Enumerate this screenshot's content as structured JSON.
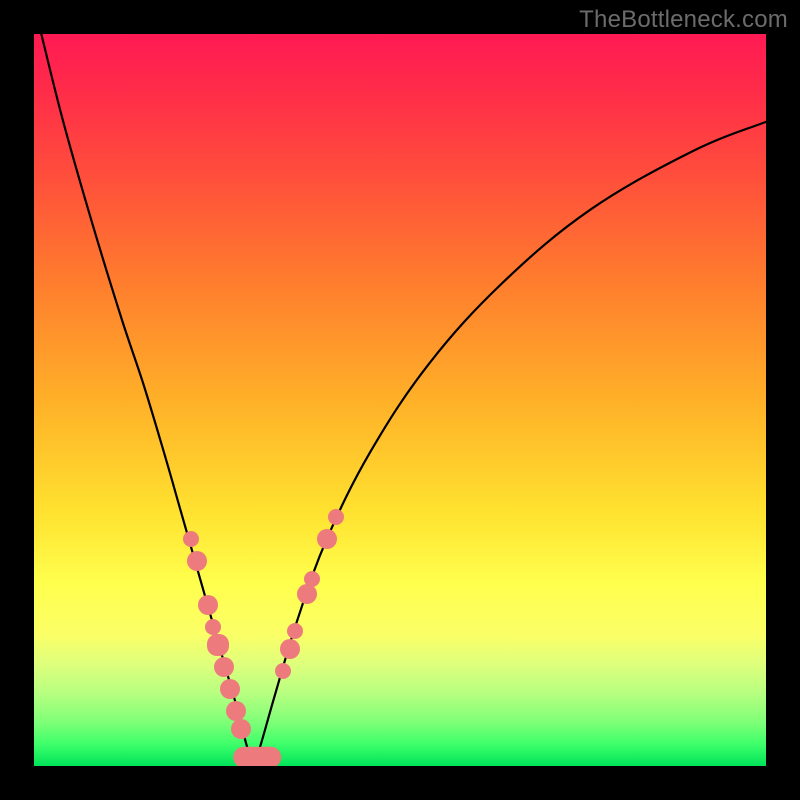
{
  "watermark": "TheBottleneck.com",
  "chart_data": {
    "type": "line",
    "title": "",
    "xlabel": "",
    "ylabel": "",
    "xlim": [
      0,
      100
    ],
    "ylim": [
      0,
      100
    ],
    "grid": false,
    "legend": false,
    "background_gradient": {
      "direction": "top-to-bottom",
      "stops": [
        {
          "pos": 0.0,
          "color": "#ff1a53"
        },
        {
          "pos": 0.18,
          "color": "#ff4a3d"
        },
        {
          "pos": 0.33,
          "color": "#ff7a2e"
        },
        {
          "pos": 0.5,
          "color": "#ffb028"
        },
        {
          "pos": 0.65,
          "color": "#ffe12f"
        },
        {
          "pos": 0.82,
          "color": "#fbff66"
        },
        {
          "pos": 0.9,
          "color": "#b8ff80"
        },
        {
          "pos": 1.0,
          "color": "#00e35a"
        }
      ]
    },
    "series": [
      {
        "name": "left-branch",
        "x": [
          1,
          4,
          8,
          12,
          15,
          18,
          20,
          22,
          24,
          26,
          28,
          29,
          30
        ],
        "y": [
          100,
          88,
          74,
          61,
          52,
          42,
          35,
          28,
          21,
          14,
          7,
          3,
          0
        ]
      },
      {
        "name": "right-branch",
        "x": [
          30,
          31,
          33,
          36,
          40,
          46,
          54,
          64,
          76,
          90,
          100
        ],
        "y": [
          0,
          3,
          10,
          20,
          31,
          43,
          55,
          66,
          76,
          84,
          88
        ]
      }
    ],
    "markers": [
      {
        "x": 21.5,
        "y": 31,
        "size": "sm"
      },
      {
        "x": 22.2,
        "y": 28,
        "size": "md"
      },
      {
        "x": 23.8,
        "y": 22,
        "size": "md"
      },
      {
        "x": 24.5,
        "y": 19,
        "size": "sm"
      },
      {
        "x": 25.2,
        "y": 16.5,
        "size": "lg"
      },
      {
        "x": 26.0,
        "y": 13.5,
        "size": "md"
      },
      {
        "x": 26.8,
        "y": 10.5,
        "size": "md"
      },
      {
        "x": 27.6,
        "y": 7.5,
        "size": "md"
      },
      {
        "x": 28.3,
        "y": 5.0,
        "size": "md"
      },
      {
        "x": 34.0,
        "y": 13,
        "size": "sm"
      },
      {
        "x": 35.0,
        "y": 16,
        "size": "md"
      },
      {
        "x": 35.7,
        "y": 18.5,
        "size": "sm"
      },
      {
        "x": 37.3,
        "y": 23.5,
        "size": "md"
      },
      {
        "x": 38.0,
        "y": 25.5,
        "size": "sm"
      },
      {
        "x": 40.0,
        "y": 31,
        "size": "md"
      },
      {
        "x": 41.2,
        "y": 34,
        "size": "sm"
      }
    ],
    "bottom_bar": {
      "x_center": 30.5,
      "y": 1.2,
      "width_pct": 6.5,
      "height_pct": 2.8
    }
  }
}
